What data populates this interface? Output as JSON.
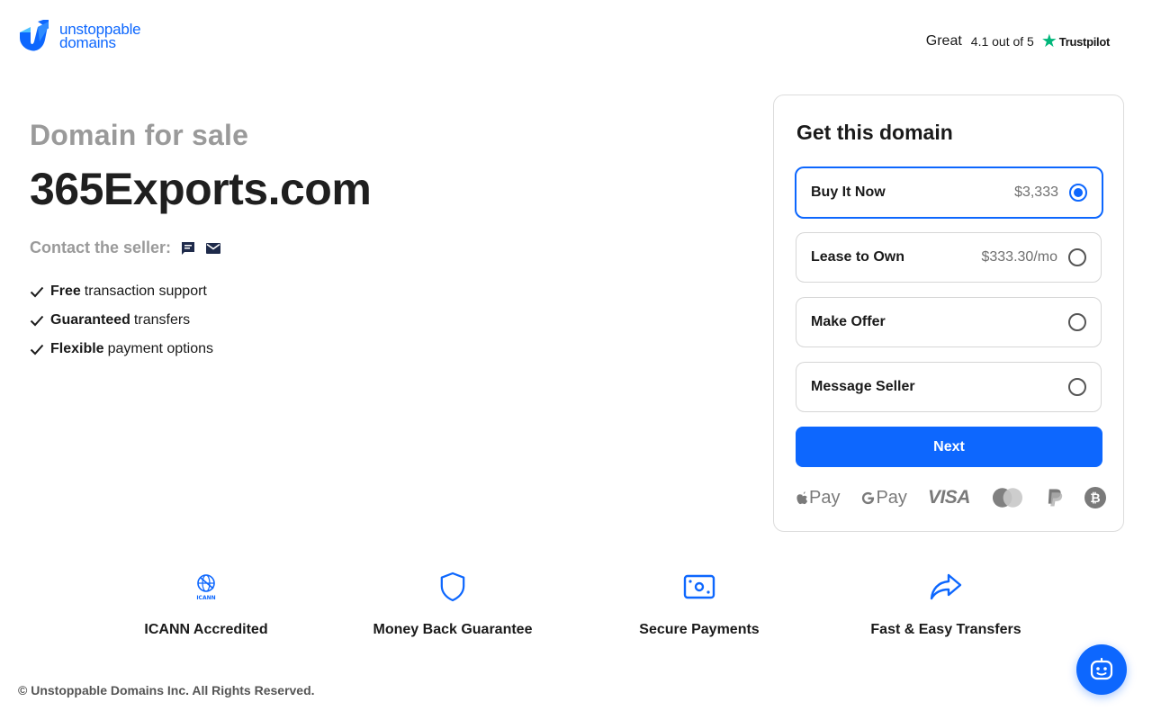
{
  "brand": {
    "name_line1": "unstoppable",
    "name_line2": "domains",
    "accent_color": "#0d67fe"
  },
  "trustpilot": {
    "rating_word": "Great",
    "score_text": "4.1 out of 5",
    "brand": "Trustpilot",
    "star_color": "#00b67a"
  },
  "listing": {
    "heading": "Domain for sale",
    "domain": "365Exports.com",
    "contact_label": "Contact the seller:",
    "contact_icons": [
      "chat-icon",
      "email-icon"
    ],
    "features": [
      {
        "bold": "Free",
        "rest": "transaction support"
      },
      {
        "bold": "Guaranteed",
        "rest": "transfers"
      },
      {
        "bold": "Flexible",
        "rest": "payment options"
      }
    ]
  },
  "purchase_card": {
    "title": "Get this domain",
    "options": [
      {
        "label": "Buy It Now",
        "price": "$3,333",
        "selected": true
      },
      {
        "label": "Lease to Own",
        "price": "$333.30/mo",
        "selected": false
      },
      {
        "label": "Make Offer",
        "price": "",
        "selected": false
      },
      {
        "label": "Message Seller",
        "price": "",
        "selected": false
      }
    ],
    "next_label": "Next",
    "payment_methods": {
      "apple_pay": "Pay",
      "google_pay": "Pay",
      "visa": "VISA"
    },
    "payment_icons": [
      "apple-pay-icon",
      "google-pay-icon",
      "visa-icon",
      "mastercard-icon",
      "paypal-icon",
      "bitcoin-icon"
    ]
  },
  "benefits": [
    {
      "icon": "icann-icon",
      "label": "ICANN Accredited",
      "icon_text": "ICANN"
    },
    {
      "icon": "shield-icon",
      "label": "Money Back Guarantee"
    },
    {
      "icon": "cash-icon",
      "label": "Secure Payments"
    },
    {
      "icon": "share-arrow-icon",
      "label": "Fast & Easy Transfers"
    }
  ],
  "footer": {
    "copyright": "© Unstoppable Domains Inc. All Rights Reserved."
  },
  "chat_widget": {
    "icon": "chatbot-icon"
  }
}
